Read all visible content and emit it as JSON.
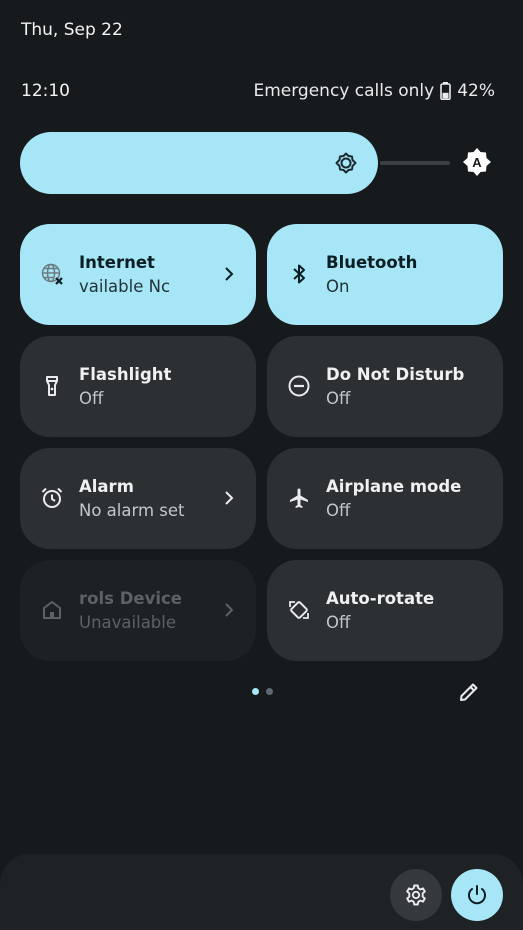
{
  "status_bar": {
    "date": "Thu, Sep 22",
    "time": "12:10",
    "network_status": "Emergency calls only",
    "battery_percent": "42%",
    "battery_level": 0.42
  },
  "brightness": {
    "level": 0.85,
    "auto_icon": "auto-brightness-icon"
  },
  "tiles": [
    {
      "title": "Internet",
      "subtitle": "vailable        Nc",
      "icon": "globe-off-icon",
      "state": "on",
      "chevron": true
    },
    {
      "title": "Bluetooth",
      "subtitle": "On",
      "icon": "bluetooth-icon",
      "state": "on",
      "chevron": false
    },
    {
      "title": "Flashlight",
      "subtitle": "Off",
      "icon": "flashlight-icon",
      "state": "off",
      "chevron": false
    },
    {
      "title": "Do Not Disturb",
      "subtitle": "Off",
      "icon": "do-not-disturb-icon",
      "state": "off",
      "chevron": false
    },
    {
      "title": "Alarm",
      "subtitle": "No alarm set",
      "icon": "alarm-icon",
      "state": "off",
      "chevron": true
    },
    {
      "title": "Airplane mode",
      "subtitle": "Off",
      "icon": "airplane-icon",
      "state": "off",
      "chevron": false
    },
    {
      "title": "rols        Device",
      "subtitle": "Unavailable",
      "icon": "home-icon",
      "state": "unavailable",
      "chevron": true
    },
    {
      "title": "Auto-rotate",
      "subtitle": "Off",
      "icon": "rotate-icon",
      "state": "off",
      "chevron": false
    }
  ],
  "pager": {
    "pages": 2,
    "current": 1
  },
  "colors": {
    "accent": "#a6e6f6",
    "background": "#171a1c",
    "tile_off": "#2d3033"
  }
}
